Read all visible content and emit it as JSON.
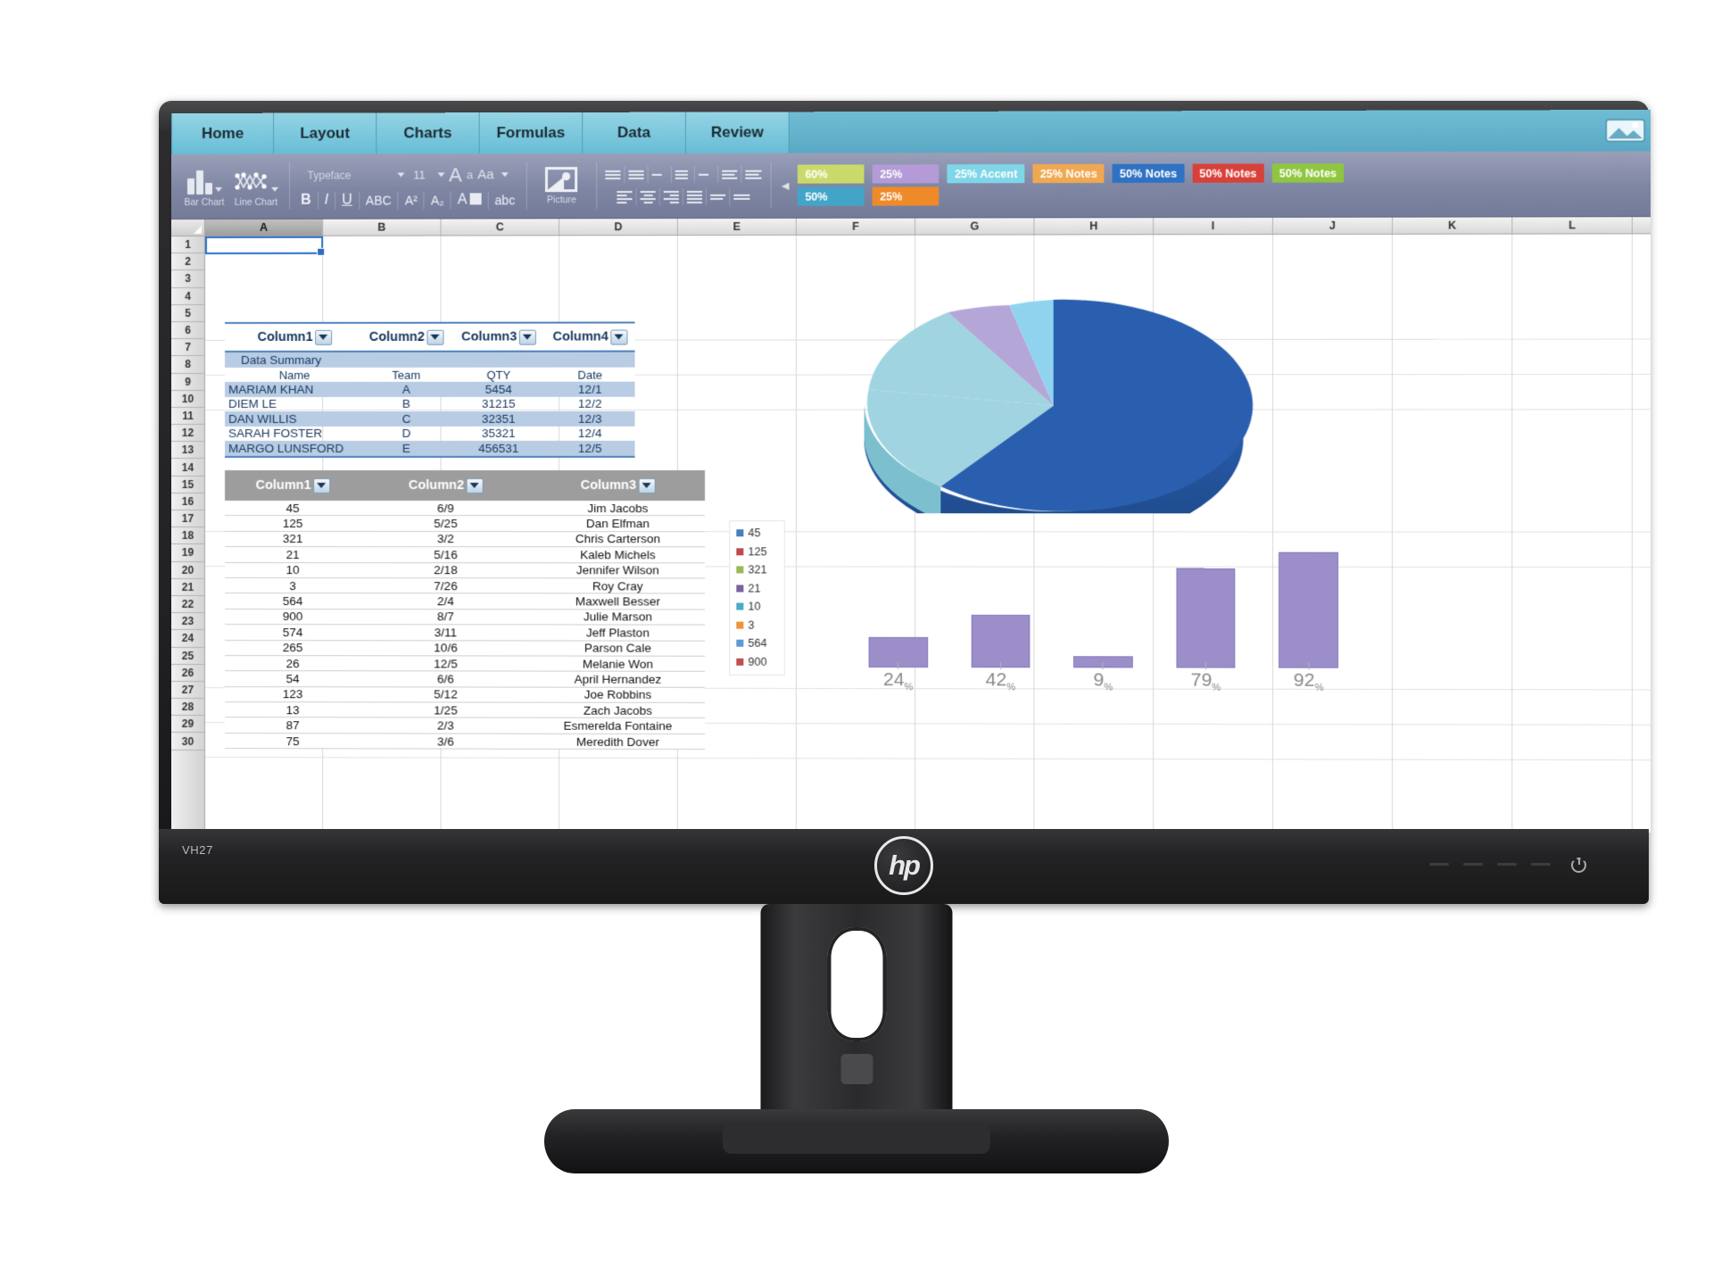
{
  "app": {
    "tabs": [
      "Home",
      "Layout",
      "Charts",
      "Formulas",
      "Data",
      "Review"
    ],
    "tabbar_icon": "picture-gallery-icon"
  },
  "ribbon": {
    "chart_buttons": [
      {
        "label": "Bar Chart",
        "icon": "bar-chart-icon"
      },
      {
        "label": "Line Chart",
        "icon": "line-chart-icon"
      }
    ],
    "font": {
      "typeface_placeholder": "Typeface",
      "typeface_value": "",
      "size_value": "11",
      "grow_label": "A",
      "shrink_label": "a",
      "case_label": "Aa",
      "bold_label": "B",
      "italic_label": "I",
      "underline_label": "U",
      "strike_label": "ABC",
      "superscript_label": "A²",
      "subscript_label": "A₂",
      "color_label": "A",
      "highlight_label": "abc"
    },
    "picture": {
      "label": "Picture",
      "icon": "picture-icon"
    },
    "styles_prev_icon": "scroll-left-icon",
    "styles": [
      {
        "label": "60%",
        "color": "#cada6a",
        "text": "#ffffff"
      },
      {
        "label": "25%",
        "color": "#b49ad6",
        "text": "#ffffff"
      },
      {
        "label": "25% Accent",
        "color": "#7ed6e8",
        "text": "#ffffff"
      },
      {
        "label": "25% Notes",
        "color": "#f0a850",
        "text": "#ffffff"
      },
      {
        "label": "50% Notes",
        "color": "#2f72c4",
        "text": "#ffffff"
      },
      {
        "label": "50% Notes",
        "color": "#d8413a",
        "text": "#ffffff"
      },
      {
        "label": "50% Notes",
        "color": "#8fc63f",
        "text": "#ffffff"
      },
      {
        "label": "50%",
        "color": "#42a5c8",
        "text": "#ffffff"
      },
      {
        "label": "25%",
        "color": "#ef8a28",
        "text": "#ffffff"
      }
    ]
  },
  "grid": {
    "columns": [
      "A",
      "B",
      "C",
      "D",
      "E",
      "F",
      "G",
      "H",
      "I",
      "J",
      "K",
      "L"
    ],
    "selected_column": "A",
    "selected_cell": "A1",
    "rows": [
      "1",
      "2",
      "3",
      "4",
      "5",
      "6",
      "7",
      "8",
      "9",
      "10",
      "11",
      "12",
      "13",
      "14",
      "15",
      "16",
      "17",
      "18",
      "19",
      "20",
      "21",
      "22",
      "23",
      "24",
      "25",
      "26",
      "27",
      "28",
      "29",
      "30"
    ]
  },
  "table1": {
    "headers": [
      "Column1",
      "Column2",
      "Column3",
      "Column4"
    ],
    "filter_icon": "filter-dropdown-icon",
    "summary_title": "Data Summary",
    "subheaders": [
      "Name",
      "Team",
      "QTY",
      "Date"
    ],
    "rows": [
      [
        "MARIAM KHAN",
        "A",
        "5454",
        "12/1"
      ],
      [
        "DIEM LE",
        "B",
        "31215",
        "12/2"
      ],
      [
        "DAN  WILLIS",
        "C",
        "32351",
        "12/3"
      ],
      [
        "SARAH FOSTER",
        "D",
        "35321",
        "12/4"
      ],
      [
        "MARGO LUNSFORD",
        "E",
        "456531",
        "12/5"
      ]
    ]
  },
  "table2": {
    "headers": [
      "Column1",
      "Column2",
      "Column3"
    ],
    "filter_icon": "filter-dropdown-icon",
    "rows": [
      [
        "45",
        "6/9",
        "Jim Jacobs"
      ],
      [
        "125",
        "5/25",
        "Dan Elfman"
      ],
      [
        "321",
        "3/2",
        "Chris Carterson"
      ],
      [
        "21",
        "5/16",
        "Kaleb Michels"
      ],
      [
        "10",
        "2/18",
        "Jennifer Wilson"
      ],
      [
        "3",
        "7/26",
        "Roy Cray"
      ],
      [
        "564",
        "2/4",
        "Maxwell Besser"
      ],
      [
        "900",
        "8/7",
        "Julie Marson"
      ],
      [
        "574",
        "3/11",
        "Jeff Plaston"
      ],
      [
        "265",
        "10/6",
        "Parson Cale"
      ],
      [
        "26",
        "12/5",
        "Melanie Won"
      ],
      [
        "54",
        "6/6",
        "April Hernandez"
      ],
      [
        "123",
        "5/12",
        "Joe Robbins"
      ],
      [
        "13",
        "1/25",
        "Zach Jacobs"
      ],
      [
        "87",
        "2/3",
        "Esmerelda Fontaine"
      ],
      [
        "75",
        "3/6",
        "Meredith Dover"
      ]
    ]
  },
  "chart_data": [
    {
      "type": "pie",
      "title": "",
      "labels": [
        "45",
        "125",
        "321",
        "21"
      ],
      "values": [
        62,
        22,
        9,
        7
      ],
      "colors": [
        "#2a5fb0",
        "#9fd4e0",
        "#b5a6d8",
        "#8fd3ef"
      ],
      "legend_position": "left",
      "three_d": true
    },
    {
      "type": "bar",
      "title": "",
      "categories": [
        "24%",
        "42%",
        "9%",
        "79%",
        "92%"
      ],
      "values": [
        24,
        42,
        9,
        79,
        92
      ],
      "ylim": [
        0,
        100
      ],
      "xlabel": "",
      "ylabel": "",
      "grid": true,
      "series_color": "#9b8ec9"
    }
  ],
  "legend": {
    "entries": [
      {
        "label": "45",
        "color": "#4a7ebb"
      },
      {
        "label": "125",
        "color": "#be4b48"
      },
      {
        "label": "321",
        "color": "#98b954"
      },
      {
        "label": "21",
        "color": "#7d60a0"
      },
      {
        "label": "10",
        "color": "#4aacc5"
      },
      {
        "label": "3",
        "color": "#f0923a"
      },
      {
        "label": "564",
        "color": "#5d9bd3"
      },
      {
        "label": "900",
        "color": "#c0504d"
      }
    ]
  },
  "monitor": {
    "model_label": "VH27",
    "brand": "hp",
    "power_icon": "power-icon"
  }
}
